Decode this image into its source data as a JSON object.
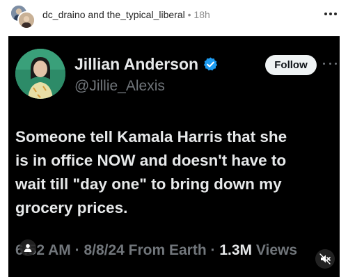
{
  "post": {
    "author_primary": "dc_draino",
    "connector": "and",
    "author_secondary": "the_typical_liberal",
    "separator": "•",
    "timestamp": "18h",
    "avatar_icons": [
      "avatar-dc-draino",
      "avatar-the-typical-liberal"
    ],
    "more_icon": "more-horizontal-icon"
  },
  "tweet": {
    "display_name": "Jillian Anderson",
    "verified_icon": "verified-badge-icon",
    "verified_color": "#1d9bf0",
    "handle": "@Jillie_Alexis",
    "follow_label": "Follow",
    "body_lines": [
      "Someone tell Kamala Harris that she",
      "is in office NOW and doesn't have to",
      "wait till \"day one\" to bring down my",
      "grocery prices."
    ],
    "meta_time": "6:52 AM",
    "meta_sep": "·",
    "meta_date": "8/8/24 From Earth",
    "meta_views_count": "1.3M",
    "meta_views_label": "Views"
  },
  "overlay": {
    "user_tag_icon": "user-tag-icon",
    "mute_icon": "speaker-muted-icon"
  },
  "colors": {
    "card_bg": "#000000",
    "text_primary": "#e7e9ea",
    "text_secondary": "#71767b",
    "follow_bg": "#eff3f4"
  }
}
